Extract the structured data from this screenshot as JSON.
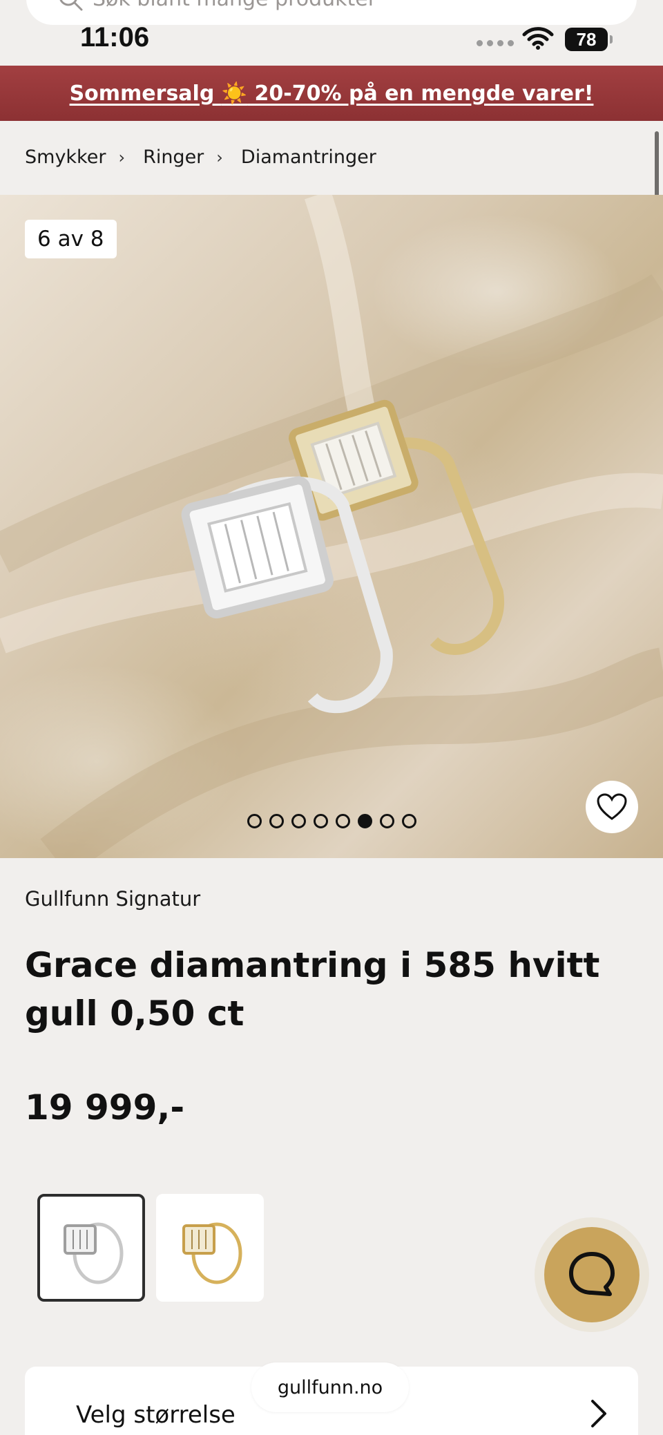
{
  "search": {
    "placeholder": "Søk blant mange produkter"
  },
  "status_bar": {
    "time": "11:06",
    "battery": "78"
  },
  "promo": {
    "text_before": "Sommersalg ",
    "sun": "☀️",
    "text_after": " 20-70% på en mengde varer!",
    "color": "#a23f41"
  },
  "breadcrumb": {
    "items": [
      "Smykker",
      "Ringer",
      "Diamantringer"
    ]
  },
  "gallery": {
    "counter": "6 av 8",
    "total": 8,
    "active_index": 5
  },
  "product": {
    "brand": "Gullfunn Signatur",
    "title": "Grace diamantring i 585 hvitt gull 0,50 ct",
    "price": "19 999,-"
  },
  "variants": [
    {
      "metal": "white-gold",
      "selected": true
    },
    {
      "metal": "yellow-gold",
      "selected": false
    }
  ],
  "size_selector": {
    "label": "Velg størrelse"
  },
  "browser": {
    "url": "gullfunn.no"
  },
  "colors": {
    "accent_gold": "#c9a45c",
    "promo_red": "#a23f41"
  }
}
